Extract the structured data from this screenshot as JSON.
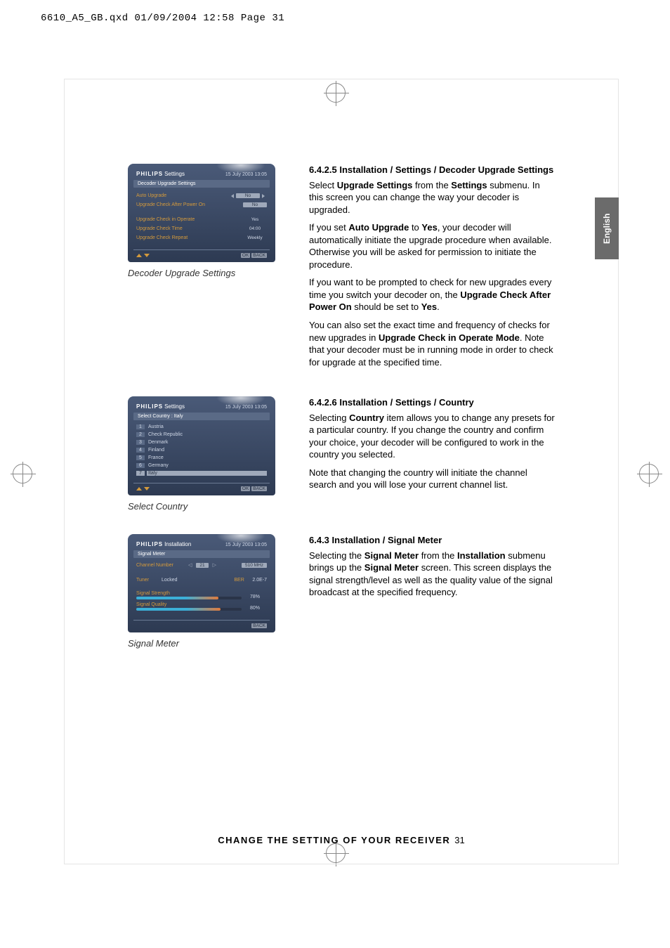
{
  "slug": "6610_A5_GB.qxd  01/09/2004  12:58  Page 31",
  "lang_tab": "English",
  "footer": {
    "title": "CHANGE THE SETTING OF YOUR RECEIVER",
    "page": "31"
  },
  "fig1": {
    "brand": "PHILIPS",
    "title": "Settings",
    "time": "15 July 2003   13:05",
    "subtitle": "Decoder Upgrade Settings",
    "rows": [
      {
        "label": "Auto Upgrade",
        "value": "No",
        "arrows": true
      },
      {
        "label": "Upgrade Check After Power On",
        "value": "No",
        "arrows": false
      },
      {
        "label": "Upgrade Check in Operate",
        "value": "Yes",
        "bare": true
      },
      {
        "label": "Upgrade Check Time",
        "value": "04:00",
        "bare": true
      },
      {
        "label": "Upgrade Check Repeat",
        "value": "Weekly",
        "bare": true
      }
    ],
    "foot_ok": "OK",
    "foot_back": "BACK",
    "caption": "Decoder Upgrade Settings"
  },
  "fig2": {
    "brand": "PHILIPS",
    "title": "Settings",
    "time": "15 July 2003   13:05",
    "subtitle": "Select Country : Italy",
    "countries": [
      {
        "idx": "1",
        "name": "Austria"
      },
      {
        "idx": "2",
        "name": "Check Republic"
      },
      {
        "idx": "3",
        "name": "Denmark"
      },
      {
        "idx": "4",
        "name": "Finland"
      },
      {
        "idx": "5",
        "name": "France"
      },
      {
        "idx": "6",
        "name": "Germany"
      },
      {
        "idx": "7",
        "name": "Italy"
      }
    ],
    "foot_ok": "OK",
    "foot_back": "BACK",
    "caption": "Select Country"
  },
  "fig3": {
    "brand": "PHILIPS",
    "title": "Installation",
    "time": "15 July 2003   13:05",
    "subtitle": "Signal Meter",
    "ch_label": "Channel Number",
    "ch_value": "21",
    "freq": "510 MHz",
    "tuner_lbl": "Tuner",
    "tuner_val": "Locked",
    "ber_lbl": "BER",
    "ber_val": "2.0E-7",
    "strength_lbl": "Signal Strength",
    "strength_pct": "78%",
    "strength_fill": 78,
    "quality_lbl": "Signal Quality",
    "quality_pct": "80%",
    "quality_fill": 80,
    "foot_back": "BACK",
    "caption": "Signal Meter"
  },
  "sec1": {
    "h": "6.4.2.5 Installation / Settings / Decoder Upgrade Settings",
    "p1a": "Select ",
    "p1b": "Upgrade Settings",
    "p1c": " from the ",
    "p1d": "Settings",
    "p1e": " submenu. In this screen you can change the way your decoder is upgraded.",
    "p2a": "If you set ",
    "p2b": "Auto Upgrade",
    "p2c": " to ",
    "p2d": "Yes",
    "p2e": ", your decoder will automatically initiate the upgrade procedure when available. Otherwise you will be asked for permission to initiate the procedure.",
    "p3a": "If you want to be prompted to check for new upgrades every time you switch your decoder on, the ",
    "p3b": "Upgrade Check After Power On",
    "p3c": " should be set to ",
    "p3d": "Yes",
    "p3e": ".",
    "p4a": "You can also set the exact time and frequency of checks for new upgrades in ",
    "p4b": "Upgrade Check in Operate Mode",
    "p4c": ". Note that your decoder must be in running  mode in order to check for upgrade at the specified time."
  },
  "sec2": {
    "h": "6.4.2.6 Installation / Settings / Country",
    "p1a": "Selecting ",
    "p1b": "Country",
    "p1c": " item allows you to change any presets for a particular country. If you change the country and confirm your choice, your decoder will be configured to work in the country you selected.",
    "p2": "Note that changing the country will initiate the channel search and you will lose your current channel list."
  },
  "sec3": {
    "h": "6.4.3  Installation / Signal Meter",
    "p1a": "Selecting the ",
    "p1b": "Signal Meter",
    "p1c": " from the ",
    "p1d": "Installation",
    "p1e": " submenu brings up the ",
    "p1f": "Signal Meter",
    "p1g": " screen. This screen displays the signal strength/level as well as the quality value of the signal broadcast at the specified frequency."
  }
}
